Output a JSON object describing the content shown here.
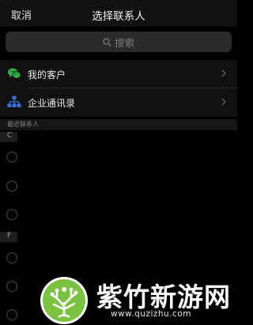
{
  "nav": {
    "cancel_label": "取消",
    "title": "选择联系人"
  },
  "search": {
    "placeholder": "搜索",
    "icon": "search-icon"
  },
  "menu": [
    {
      "label": "我的客户",
      "icon": "wechat-icon",
      "icon_color": "#2fb24a"
    },
    {
      "label": "企业通讯录",
      "icon": "org-chart-icon",
      "icon_color": "#3a6fd8"
    }
  ],
  "recent_header": "最近联系人",
  "sections": [
    {
      "letter": "C"
    },
    {
      "letter": "F"
    }
  ],
  "watermark": {
    "brand": "紫竹新游网",
    "url": "www.quzizhu.com",
    "accent": "#7cc241"
  }
}
